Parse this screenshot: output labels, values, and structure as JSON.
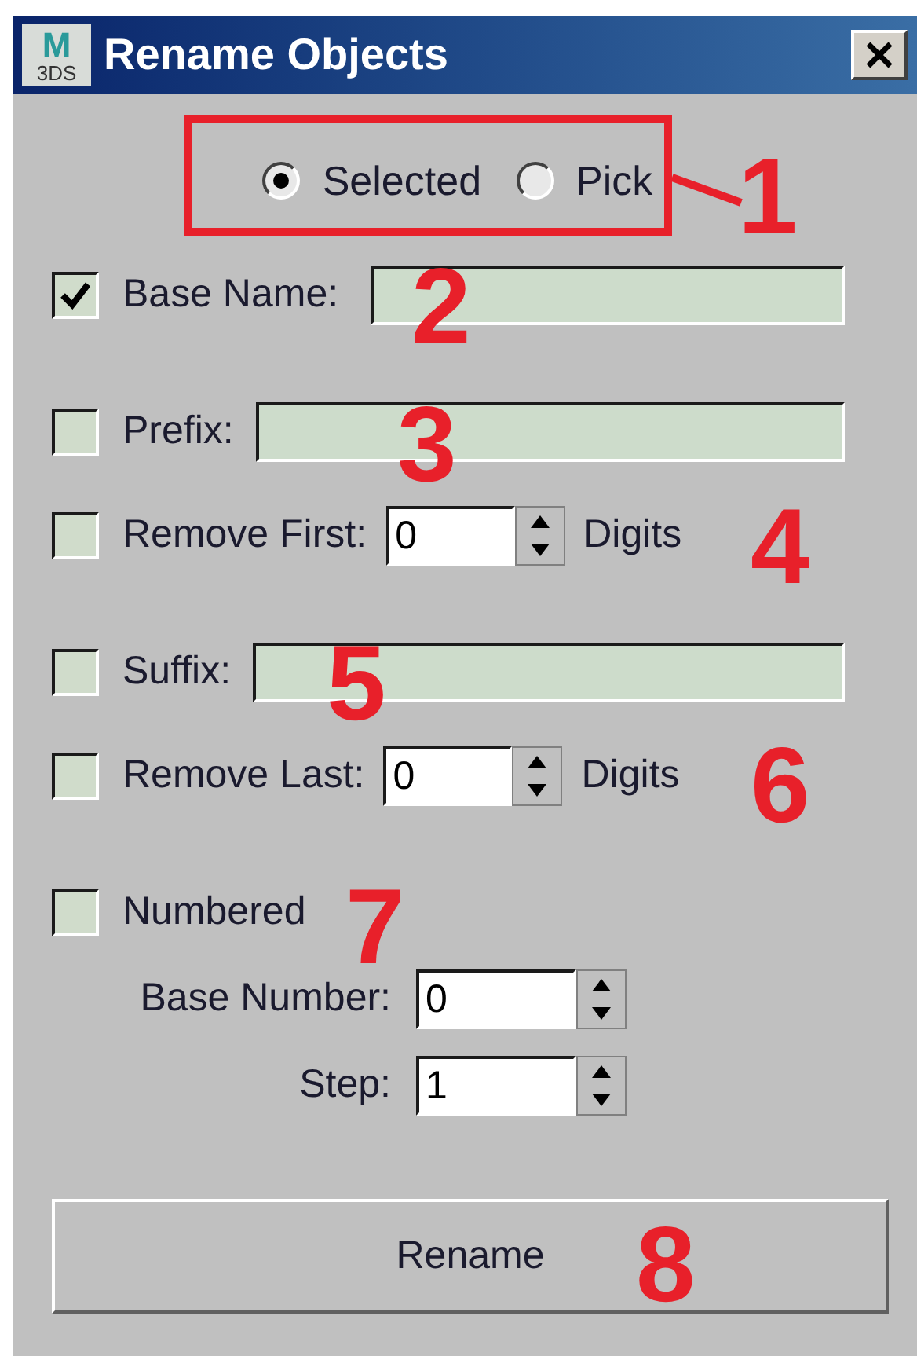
{
  "window": {
    "title": "Rename Objects",
    "logo": {
      "top": "M",
      "bottom": "3DS"
    }
  },
  "source": [
    {
      "label": "Selected",
      "selected": true
    },
    {
      "label": "Pick",
      "selected": false
    }
  ],
  "groups": [
    [
      {
        "kind": "text",
        "label": "Base Name:",
        "checked": true
      }
    ],
    [
      {
        "kind": "text",
        "label": "Prefix:",
        "checked": false
      },
      {
        "kind": "count",
        "label": "Remove First:",
        "checked": false,
        "value": "0",
        "unit": "Digits"
      }
    ],
    [
      {
        "kind": "text",
        "label": "Suffix:",
        "checked": false
      },
      {
        "kind": "count",
        "label": "Remove Last:",
        "checked": false,
        "value": "0",
        "unit": "Digits"
      }
    ],
    [
      {
        "kind": "check",
        "label": "Numbered",
        "checked": false
      },
      {
        "kind": "spinner",
        "label": "Base Number:",
        "value": "0"
      },
      {
        "kind": "spinner",
        "label": "Step:",
        "value": "1"
      }
    ]
  ],
  "button": "Rename",
  "callouts": [
    "1",
    "2",
    "3",
    "4",
    "5",
    "6",
    "7",
    "8"
  ]
}
